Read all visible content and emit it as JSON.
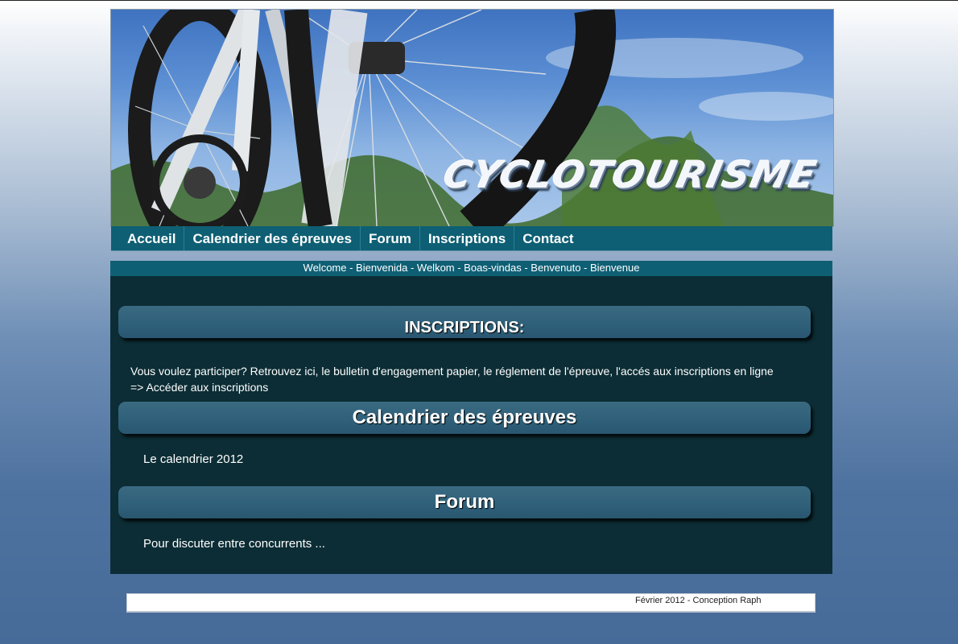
{
  "banner": {
    "title": "CYCLOTOURISME"
  },
  "nav": [
    {
      "label": "Accueil"
    },
    {
      "label": "Calendrier des épreuves"
    },
    {
      "label": "Forum"
    },
    {
      "label": "Inscriptions"
    },
    {
      "label": "Contact"
    }
  ],
  "welcome": "Welcome - Bienvenida - Welkom - Boas-vindas - Benvenuto - Bienvenue",
  "sections": {
    "inscriptions": {
      "title": "INSCRIPTIONS:",
      "text": "Vous voulez participer? Retrouvez ici, le bulletin d'engagement papier, le réglement de l'épreuve, l'accés aux inscriptions en ligne",
      "link": "=> Accéder aux inscriptions"
    },
    "calendrier": {
      "title": "Calendrier des épreuves",
      "text": "Le calendrier 2012"
    },
    "forum": {
      "title": "Forum",
      "text": "Pour discuter entre concurrents ..."
    }
  },
  "footer": {
    "text": "Février 2012 - Conception Raph"
  },
  "colors": {
    "nav_bg": "#0e5f74",
    "content_bg": "#0c2d35",
    "header_bg": "#2f6079"
  }
}
